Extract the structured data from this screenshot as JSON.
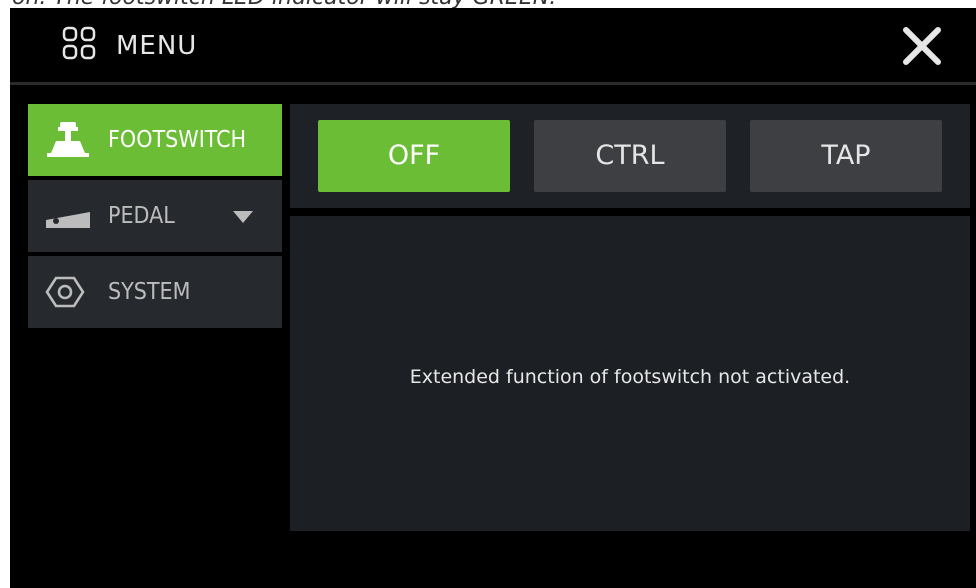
{
  "caption": "on. The footswitch LED indicator will stay GREEN.",
  "header": {
    "menu_label": "MENU",
    "menu_icon": "grid-icon",
    "close_icon": "close-icon"
  },
  "sidebar": {
    "items": [
      {
        "label": "FOOTSWITCH",
        "icon": "footswitch-icon",
        "active": true
      },
      {
        "label": "PEDAL",
        "icon": "pedal-icon",
        "active": false
      },
      {
        "label": "SYSTEM",
        "icon": "hex-nut-icon",
        "active": false
      }
    ]
  },
  "tabs": [
    {
      "label": "OFF",
      "active": true
    },
    {
      "label": "CTRL",
      "active": false
    },
    {
      "label": "TAP",
      "active": false
    }
  ],
  "content": {
    "message": "Extended function of footswitch not activated."
  },
  "colors": {
    "accent_green": "#6bbd35",
    "panel": "#262a2e",
    "tab_inactive": "#3d3f42",
    "background": "#000000"
  }
}
